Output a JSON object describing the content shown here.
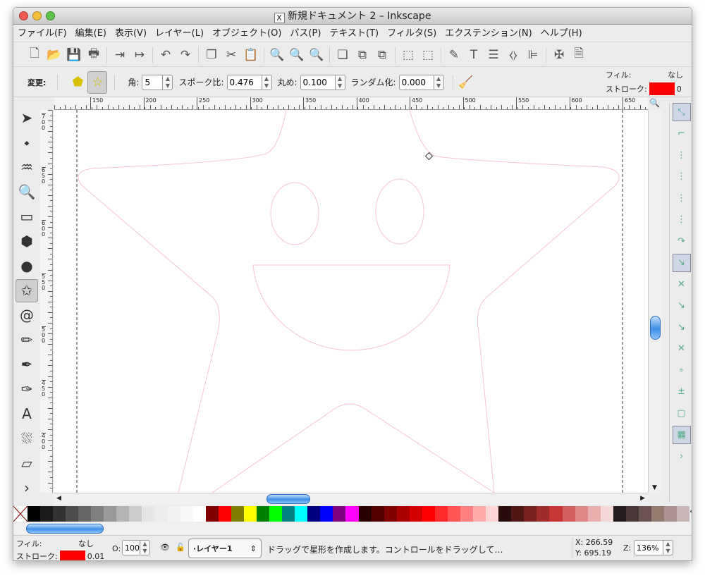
{
  "window": {
    "title": "新規ドキュメント 2 – Inkscape",
    "app_icon": "x11-icon"
  },
  "menu": [
    "ファイル(F)",
    "編集(E)",
    "表示(V)",
    "レイヤー(L)",
    "オブジェクト(O)",
    "パス(P)",
    "テキスト(T)",
    "フィルタ(S)",
    "エクステンション(N)",
    "ヘルプ(H)"
  ],
  "toolbar": [
    {
      "icon": "new-document-icon",
      "g": "🗋"
    },
    {
      "icon": "open-icon",
      "g": "📂"
    },
    {
      "icon": "save-icon",
      "g": "💾"
    },
    {
      "icon": "print-icon",
      "g": "🖶"
    },
    {
      "sep": true
    },
    {
      "icon": "import-icon",
      "g": "⇥"
    },
    {
      "icon": "export-icon",
      "g": "↦"
    },
    {
      "sep": true
    },
    {
      "icon": "undo-icon",
      "g": "↶"
    },
    {
      "icon": "redo-icon",
      "g": "↷"
    },
    {
      "sep": true
    },
    {
      "icon": "duplicate-icon",
      "g": "❐"
    },
    {
      "icon": "cut-icon",
      "g": "✂"
    },
    {
      "icon": "paste-icon",
      "g": "📋"
    },
    {
      "sep": true
    },
    {
      "icon": "zoom-selection-icon",
      "g": "🔍"
    },
    {
      "icon": "zoom-drawing-icon",
      "g": "🔍"
    },
    {
      "icon": "zoom-page-icon",
      "g": "🔍"
    },
    {
      "sep": true
    },
    {
      "icon": "duplicate-object-icon",
      "g": "❏"
    },
    {
      "icon": "clone-icon",
      "g": "⧉"
    },
    {
      "icon": "unlink-clone-icon",
      "g": "⧉"
    },
    {
      "sep": true
    },
    {
      "icon": "group-icon",
      "g": "⬚"
    },
    {
      "icon": "ungroup-icon",
      "g": "⬚"
    },
    {
      "sep": true
    },
    {
      "icon": "fill-stroke-icon",
      "g": "✎"
    },
    {
      "icon": "text-font-icon",
      "g": "T"
    },
    {
      "icon": "layers-icon",
      "g": "☰"
    },
    {
      "icon": "xml-editor-icon",
      "g": "⧼⧽"
    },
    {
      "icon": "align-icon",
      "g": "⊫"
    },
    {
      "sep": true
    },
    {
      "icon": "preferences-icon",
      "g": "✠"
    },
    {
      "icon": "document-properties-icon",
      "g": "🗎"
    }
  ],
  "controls": {
    "change_label": "変更:",
    "corners_label": "角:",
    "corners_value": "5",
    "spoke_label": "スポーク比:",
    "spoke_value": "0.476",
    "rounded_label": "丸め:",
    "rounded_value": "0.100",
    "random_label": "ランダム化:",
    "random_value": "0.000",
    "fill_label": "フィル:",
    "fill_value": "なし",
    "stroke_label": "ストローク:",
    "stroke_width": "0",
    "stroke_color": "#ff0000"
  },
  "rulers": {
    "h": [
      "150",
      "200",
      "250",
      "300",
      "350",
      "400",
      "450",
      "500",
      "550",
      "600",
      "650"
    ],
    "v": [
      "700",
      "650",
      "600",
      "550",
      "500",
      "450",
      "400"
    ]
  },
  "tools": [
    "selector-tool-icon",
    "node-tool-icon",
    "tweak-tool-icon",
    "zoom-tool-icon",
    "rectangle-tool-icon",
    "3d-box-tool-icon",
    "ellipse-tool-icon",
    "star-tool-icon",
    "spiral-tool-icon",
    "pencil-tool-icon",
    "pen-tool-icon",
    "calligraphy-tool-icon",
    "text-tool-icon",
    "spray-tool-icon",
    "eraser-tool-icon",
    "more-tools-icon"
  ],
  "tool_glyphs": [
    "➤",
    "⬩",
    "♒",
    "🔍",
    "▭",
    "⬢",
    "●",
    "✩",
    "@",
    "✏",
    "✒",
    "✑",
    "A",
    "⛆",
    "▱",
    "›"
  ],
  "active_tool": 7,
  "snaps": [
    "snap-toggle-icon",
    "snap-bbox-icon",
    "snap-bbox-edge-icon",
    "snap-bbox-corner-icon",
    "snap-bbox-midpoint-icon",
    "snap-bbox-center-icon",
    "snap-nodes-icon",
    "snap-path-icon",
    "snap-intersection-icon",
    "snap-cusp-icon",
    "snap-smooth-icon",
    "snap-midpoint-icon",
    "snap-object-center-icon",
    "snap-rotation-center-icon",
    "snap-page-border-icon",
    "snap-grid-icon",
    "more-snaps-icon"
  ],
  "snap_glyphs": [
    "⤡",
    "⌐",
    "⋮",
    "⋮",
    "⋮",
    "⋮",
    "↷",
    "↘",
    "✕",
    "↘",
    "↘",
    "✕",
    "∘",
    "±",
    "▢",
    "▦",
    "›"
  ],
  "palette": [
    "#000000",
    "#1a1a1a",
    "#333333",
    "#4d4d4d",
    "#666666",
    "#808080",
    "#999999",
    "#b3b3b3",
    "#cccccc",
    "#e6e6e6",
    "#ececec",
    "#f2f2f2",
    "#f8f8f8",
    "#ffffff",
    "#800000",
    "#ff0000",
    "#808000",
    "#ffff00",
    "#008000",
    "#00ff00",
    "#008080",
    "#00ffff",
    "#000080",
    "#0000ff",
    "#800080",
    "#ff00ff",
    "#2b0000",
    "#550000",
    "#800000",
    "#aa0000",
    "#d40000",
    "#ff0000",
    "#ff2a2a",
    "#ff5555",
    "#ff8080",
    "#ffaaaa",
    "#ffd5d5",
    "#280b0b",
    "#501616",
    "#782121",
    "#a02c2c",
    "#c83737",
    "#d35f5f",
    "#de8787",
    "#e9afaf",
    "#f4d7d7",
    "#241c1c",
    "#483737",
    "#6c5353",
    "#917c6f",
    "#ac9393",
    "#c8b7b7"
  ],
  "canvas": {
    "stroke": "#f4c6cf"
  },
  "status": {
    "fill_label": "フィル:",
    "fill_value": "なし",
    "stroke_label": "ストローク:",
    "stroke_value": "0.01",
    "stroke_color": "#ff0000",
    "opacity_label": "O:",
    "opacity_value": "100",
    "layer": "·レイヤー1",
    "message": "ドラッグで星形を作成します。コントロールをドラッグして…",
    "x_label": "X:",
    "x_value": "266.59",
    "y_label": "Y:",
    "y_value": "695.19",
    "zoom_label": "Z:",
    "zoom_value": "136%"
  }
}
